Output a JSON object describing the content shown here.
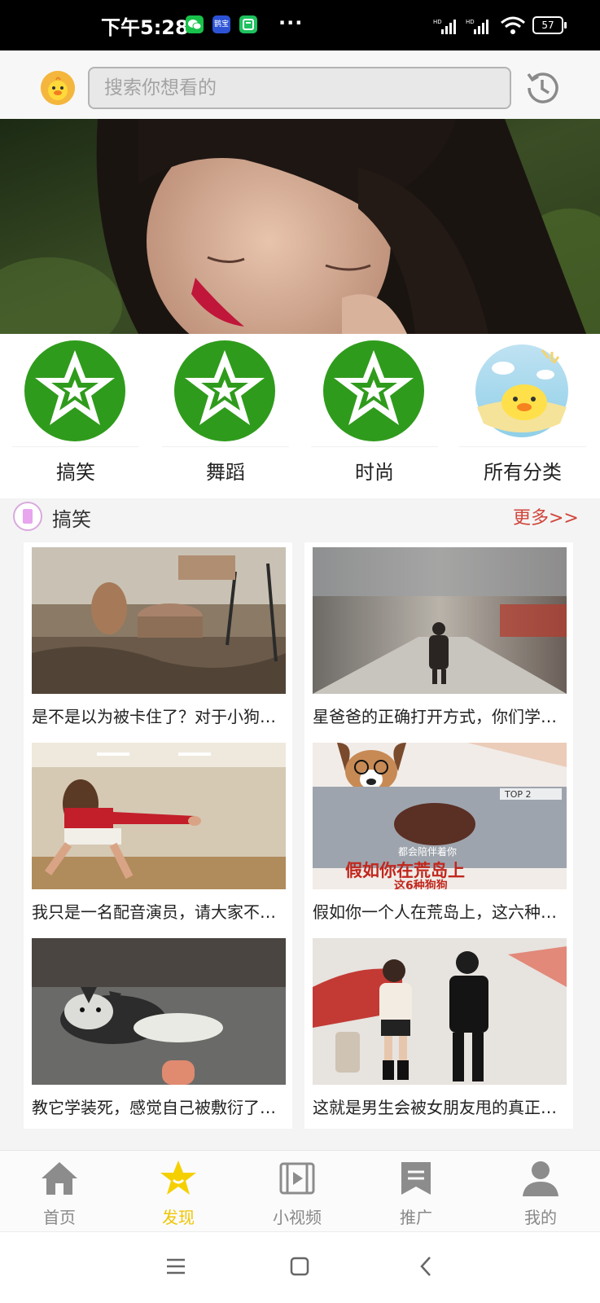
{
  "status_bar": {
    "time": "下午5:28",
    "apps": [
      "wechat-icon",
      "app-icon",
      "notes-icon"
    ],
    "app_labels": [
      "",
      "鹊宝",
      ""
    ],
    "more": "···",
    "network_labels": [
      "HD",
      "HD"
    ],
    "battery": "57"
  },
  "search": {
    "placeholder": "搜索你想看的"
  },
  "categories": [
    {
      "label": "搞笑",
      "icon": "star-icon"
    },
    {
      "label": "舞蹈",
      "icon": "star-icon"
    },
    {
      "label": "时尚",
      "icon": "star-icon"
    },
    {
      "label": "所有分类",
      "icon": "duck-icon"
    }
  ],
  "section": {
    "title": "搞笑",
    "more": "更多>>"
  },
  "videos": [
    {
      "title": "是不是以为被卡住了？对于小狗来说"
    },
    {
      "title": "星爸爸的正确打开方式，你们学会了吗"
    },
    {
      "title": "我只是一名配音演员，请大家不要误会"
    },
    {
      "title": "假如你一个人在荒岛上，这六种狗狗"
    },
    {
      "title": "教它学装死，感觉自己被敷衍了怎么办"
    },
    {
      "title": "这就是男生会被女朋友甩的真正原因"
    }
  ],
  "thumb_overlays": {
    "top_badge": "TOP 2",
    "caption_small": "都会陪伴着你",
    "caption_big": "假如你在荒岛上",
    "caption_sub": "这6种狗狗"
  },
  "tabs": [
    {
      "label": "首页",
      "icon": "home-icon",
      "active": false
    },
    {
      "label": "发现",
      "icon": "star-face-icon",
      "active": true
    },
    {
      "label": "小视频",
      "icon": "film-icon",
      "active": false
    },
    {
      "label": "推广",
      "icon": "bookmark-icon",
      "active": false
    },
    {
      "label": "我的",
      "icon": "user-icon",
      "active": false
    }
  ],
  "colors": {
    "accent_yellow": "#f0c400",
    "more_red": "#d0453b",
    "star_green": "#2f9b1c"
  }
}
